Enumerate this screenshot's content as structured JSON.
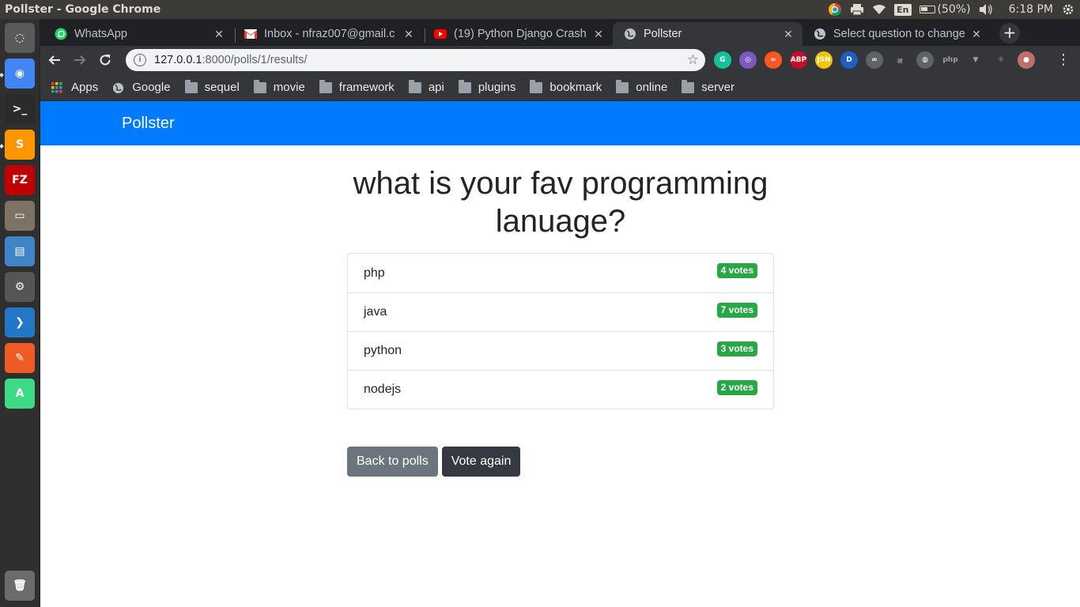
{
  "window": {
    "title": "Pollster - Google Chrome"
  },
  "system_tray": {
    "language": "En",
    "battery": "(50%)",
    "time": "6:18 PM"
  },
  "launcher": {
    "items": [
      {
        "name": "dash-icon",
        "color": "#5a5a5a",
        "glyph": "◌"
      },
      {
        "name": "chrome-icon",
        "color": "#4285f4",
        "glyph": "◉"
      },
      {
        "name": "terminal-icon",
        "color": "#2b2b2b",
        "glyph": ">_"
      },
      {
        "name": "sublime-icon",
        "color": "#ff9800",
        "glyph": "S"
      },
      {
        "name": "filezilla-icon",
        "color": "#bf0000",
        "glyph": "FZ"
      },
      {
        "name": "files-icon",
        "color": "#7d7365",
        "glyph": "▭"
      },
      {
        "name": "writer-icon",
        "color": "#3d85c6",
        "glyph": "▤"
      },
      {
        "name": "settings-icon",
        "color": "#555555",
        "glyph": "⚙"
      },
      {
        "name": "vscode-icon",
        "color": "#2277c6",
        "glyph": "❯"
      },
      {
        "name": "postman-icon",
        "color": "#ef5b25",
        "glyph": "✎"
      },
      {
        "name": "android-studio-icon",
        "color": "#3ddc84",
        "glyph": "A"
      },
      {
        "name": "trash-icon",
        "color": "#6b6b6b",
        "glyph": "🗑"
      }
    ]
  },
  "tabs": [
    {
      "title": "WhatsApp",
      "icon": "whatsapp-icon",
      "color": "#25d366"
    },
    {
      "title": "Inbox - nfraz007@gmail.c",
      "icon": "gmail-icon",
      "color": "#ea4335"
    },
    {
      "title": "(19) Python Django Crash",
      "icon": "youtube-icon",
      "color": "#ff0000"
    },
    {
      "title": "Pollster",
      "icon": "globe-icon",
      "color": "#bdc1c6"
    },
    {
      "title": "Select question to change",
      "icon": "globe-icon",
      "color": "#bdc1c6"
    }
  ],
  "toolbar": {
    "url_host": "127.0.0.1",
    "url_path": ":8000/polls/1/results/"
  },
  "extensions": [
    {
      "name": "grammarly-icon",
      "color": "#15c39a",
      "label": "G"
    },
    {
      "name": "color-picker-icon",
      "color": "#7e57c2",
      "label": "◎"
    },
    {
      "name": "infinity-orange-icon",
      "color": "#ff5722",
      "label": "∞"
    },
    {
      "name": "adblock-plus-icon",
      "color": "#c70d2c",
      "label": "ABP"
    },
    {
      "name": "json-viewer-icon",
      "color": "#f5c400",
      "label": "JSN"
    },
    {
      "name": "dashlane-icon",
      "color": "#1f5ec4",
      "label": "D"
    },
    {
      "name": "infinity-icon",
      "color": "#5f6368",
      "label": "∞"
    },
    {
      "name": "hindi-icon",
      "color": "#35363a",
      "label": "अ"
    },
    {
      "name": "globe-ext-icon",
      "color": "#5f6368",
      "label": "◍"
    },
    {
      "name": "php-icon",
      "color": "#35363a",
      "label": "php"
    },
    {
      "name": "vue-icon",
      "color": "#35363a",
      "label": "▼"
    },
    {
      "name": "react-icon",
      "color": "#35363a",
      "label": "⚛"
    },
    {
      "name": "profile-avatar",
      "color": "#c0706a",
      "label": "●"
    }
  ],
  "bookmarks": [
    {
      "label": "Apps",
      "type": "apps"
    },
    {
      "label": "Google",
      "type": "globe"
    },
    {
      "label": "sequel",
      "type": "folder"
    },
    {
      "label": "movie",
      "type": "folder"
    },
    {
      "label": "framework",
      "type": "folder"
    },
    {
      "label": "api",
      "type": "folder"
    },
    {
      "label": "plugins",
      "type": "folder"
    },
    {
      "label": "bookmark",
      "type": "folder"
    },
    {
      "label": "online",
      "type": "folder"
    },
    {
      "label": "server",
      "type": "folder"
    }
  ],
  "page": {
    "brand": "Pollster",
    "question_line1": "what is your fav programming",
    "question_line2": "lanuage?",
    "results": [
      {
        "choice": "php",
        "votes": "4 votes"
      },
      {
        "choice": "java",
        "votes": "7 votes"
      },
      {
        "choice": "python",
        "votes": "3 votes"
      },
      {
        "choice": "nodejs",
        "votes": "2 votes"
      }
    ],
    "back_label": "Back to polls",
    "vote_again_label": "Vote again"
  },
  "colors": {
    "navbar": "#007bff",
    "badge": "#28a745",
    "btn_secondary": "#6c757d",
    "btn_dark": "#343a40"
  }
}
